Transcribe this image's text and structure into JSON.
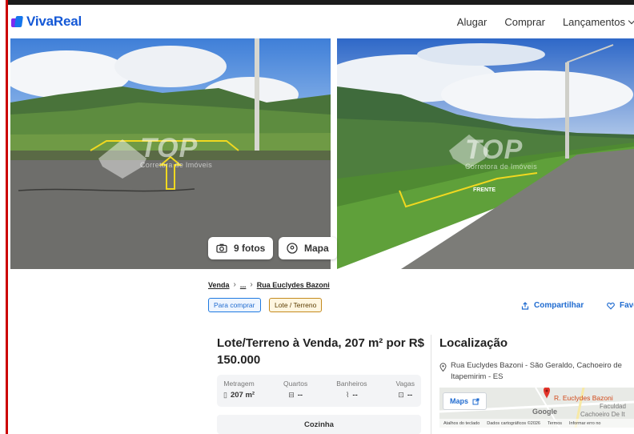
{
  "header": {
    "brand": "VivaReal",
    "nav": [
      "Alugar",
      "Comprar",
      "Lançamentos"
    ]
  },
  "gallery": {
    "photos_button": "9 fotos",
    "map_button": "Mapa",
    "watermark": "TOP",
    "watermark_sub": "Corretora de Imóveis",
    "photo2_label": "FRENTE"
  },
  "breadcrumb": {
    "first": "Venda",
    "middle": "...",
    "last": "Rua Euclydes Bazoni"
  },
  "tags": {
    "purpose": "Para comprar",
    "type": "Lote / Terreno"
  },
  "actions": {
    "share": "Compartilhar",
    "favorite": "Favoritar"
  },
  "listing": {
    "title": "Lote/Terreno à Venda, 207 m² por R$ 150.000",
    "specs": [
      {
        "label": "Metragem",
        "value": "207 m²",
        "icon": "ruler-icon"
      },
      {
        "label": "Quartos",
        "value": "--",
        "icon": "bed-icon"
      },
      {
        "label": "Banheiros",
        "value": "--",
        "icon": "shower-icon"
      },
      {
        "label": "Vagas",
        "value": "--",
        "icon": "car-icon"
      }
    ],
    "amenity": "Cozinha"
  },
  "location": {
    "title": "Localização",
    "address": "Rua Euclydes Bazoni - São Geraldo, Cachoeiro de Itapemirim - ES",
    "map_button": "Maps",
    "map_place": "R. Euclydes Bazoni",
    "map_place2": "Faculdad",
    "map_place3": "Cachoeiro De It",
    "google": "Google",
    "map_footer": [
      "Atalhos do teclado",
      "Dados cartográficos ©2026",
      "Termos",
      "Informar erro no"
    ]
  },
  "colors": {
    "brand_blue": "#1458d6",
    "link_blue": "#1f6bd0",
    "tag_orange": "#c48a1e"
  }
}
